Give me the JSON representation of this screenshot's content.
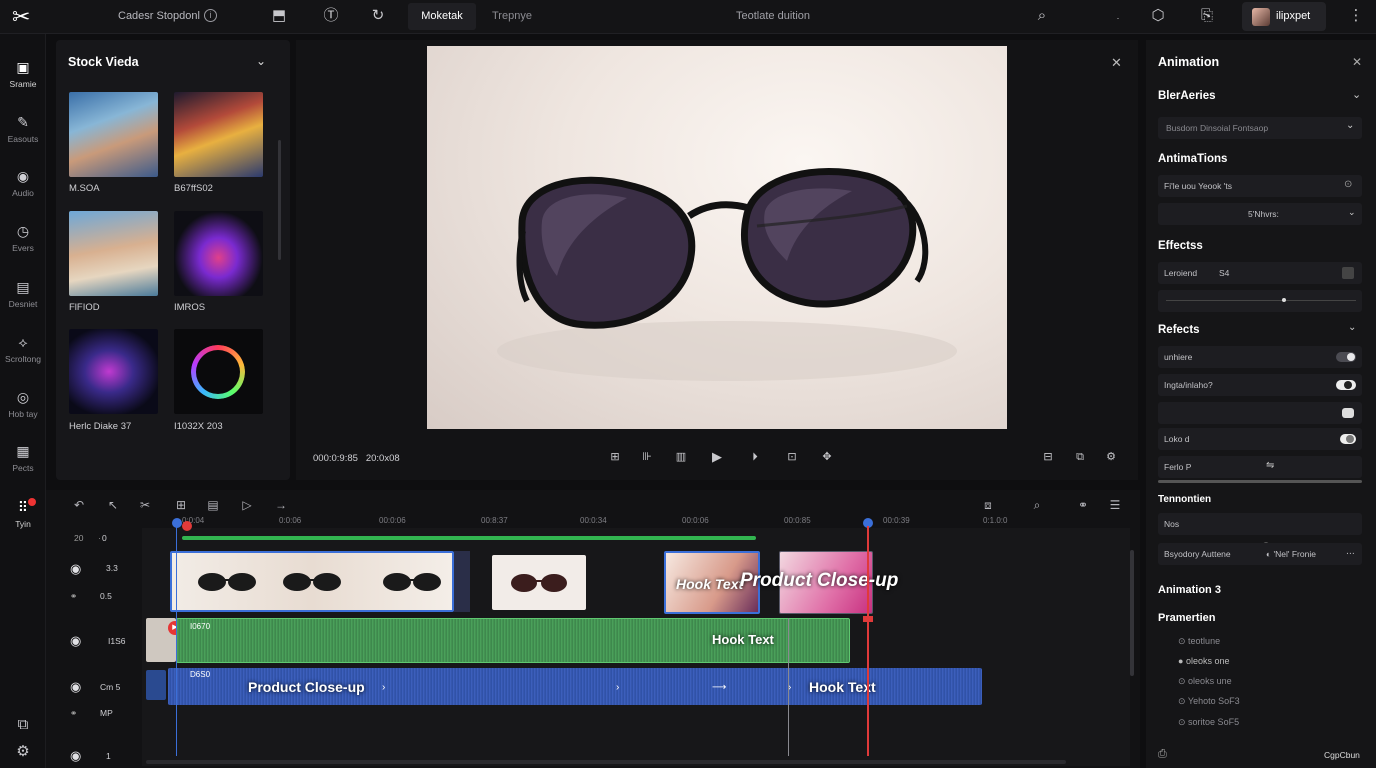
{
  "topbar": {
    "logo": "✂",
    "project_name": "Cadesr Stopdonl",
    "tabs": [
      {
        "label": "Moketak",
        "active": true
      },
      {
        "label": "Trepnye",
        "active": false
      }
    ],
    "center_title": "Teotlate duition",
    "user_name": "ilipxpet"
  },
  "rail": [
    {
      "icon": "frame-icon",
      "label": "Sramie",
      "active": true
    },
    {
      "icon": "effects-icon",
      "label": "Easouts"
    },
    {
      "icon": "audio-icon",
      "label": "Audio"
    },
    {
      "icon": "events-icon",
      "label": "Evers"
    },
    {
      "icon": "desktop-icon",
      "label": "Desniet"
    },
    {
      "icon": "scrolling-icon",
      "label": "Scroltong"
    },
    {
      "icon": "help-icon",
      "label": "Hob tay"
    },
    {
      "icon": "pects-icon",
      "label": "Pects"
    },
    {
      "icon": "grid-icon",
      "label": "Tyin",
      "active": true,
      "badge": true
    }
  ],
  "media": {
    "title": "Stock Vieda",
    "items": [
      {
        "label": "M.SOA"
      },
      {
        "label": "B67ffS02"
      },
      {
        "label": "FlFIOD"
      },
      {
        "label": "IMROS"
      },
      {
        "label": "Herlc Diake 37"
      },
      {
        "label": "I1032X 203"
      }
    ]
  },
  "preview": {
    "timecode_current": "000:0:9:85",
    "timecode_total": "20:0x08"
  },
  "right_panel": {
    "title": "Animation",
    "sec1": "BlerAeries",
    "sec1_dropdown": "Busdorn Dinsoial Fontsaop",
    "sec2": "AntimaTions",
    "sec2_row1": "Fi'le  uou  Yeook  'ts",
    "sec2_row2": "5'Nhvrs:",
    "sec3": "Effectss",
    "sec3_row1_label": "Leroiend",
    "sec3_row1_value": "S4",
    "sec4": "Refects",
    "toggles": [
      {
        "label": "unhiere",
        "on": false
      },
      {
        "label": "Ingta/inlaho?",
        "on": true
      },
      {
        "label": "",
        "on": true
      },
      {
        "label": "Loko d",
        "on": true
      },
      {
        "label": "Ferlo P",
        "on": false
      }
    ],
    "sec5": "Tennontien",
    "sec5_row": "Nos",
    "sec5_row2_left": "Bsyodory Auttene",
    "sec5_row2_right": "'Nel' Fronie",
    "sec6": "Animation 3",
    "sec7": "Pramertien",
    "radio_items": [
      "teotlune",
      "oleoks one",
      "oleoks une",
      "Yehoto SoF3",
      "soritoe SoF5"
    ],
    "footer": "CgpCbun"
  },
  "timeline": {
    "ruler": [
      "0:0:04",
      "0:0:06",
      "00:0:06",
      "00:8:37",
      "00:0:34",
      "00:0:06",
      "00:0:85",
      "00:0:39",
      "0:1.0:0"
    ],
    "tracks": [
      {
        "left": "20",
        "right": "0"
      },
      {
        "left": "",
        "right": "3.3"
      },
      {
        "left": "4",
        "right": "0.5"
      },
      {
        "left": "",
        "right": "I1S6"
      },
      {
        "left": "",
        "right": "Cm 5"
      },
      {
        "left": "6",
        "right": "MP"
      },
      {
        "left": "",
        "right": "1"
      }
    ],
    "overlay_hook": "Hook Text",
    "overlay_product": "Product Close-up",
    "audio_label": "Hook Text",
    "audio_small": "I0670",
    "voice_label_left": "Product Close-up",
    "voice_label_right": "Hook Text",
    "voice_small": "D6S0"
  },
  "colors": {
    "accent_blue": "#3b6fd8",
    "playhead_red": "#e03a3a",
    "audio_green": "#3fa052"
  }
}
